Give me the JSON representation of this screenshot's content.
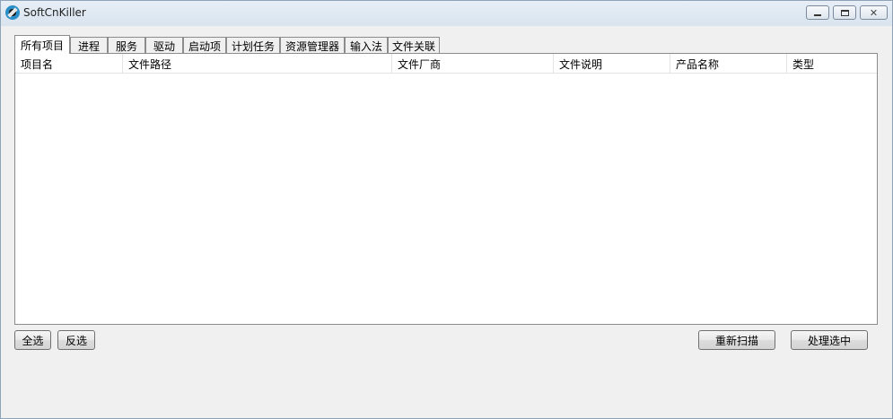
{
  "window": {
    "title": "SoftCnKiller",
    "minimize_glyph": "",
    "maximize_glyph": "",
    "close_glyph": "✕"
  },
  "tabs": [
    {
      "label": "所有项目",
      "active": true
    },
    {
      "label": "进程",
      "active": false
    },
    {
      "label": "服务",
      "active": false
    },
    {
      "label": "驱动",
      "active": false
    },
    {
      "label": "启动项",
      "active": false
    },
    {
      "label": "计划任务",
      "active": false
    },
    {
      "label": "资源管理器",
      "active": false
    },
    {
      "label": "输入法",
      "active": false
    },
    {
      "label": "文件关联",
      "active": false
    }
  ],
  "table": {
    "columns": [
      "项目名",
      "文件路径",
      "文件厂商",
      "文件说明",
      "产品名称",
      "类型"
    ],
    "rows": []
  },
  "buttons": {
    "select_all": "全选",
    "invert_selection": "反选",
    "rescan": "重新扫描",
    "process_selected": "处理选中"
  }
}
